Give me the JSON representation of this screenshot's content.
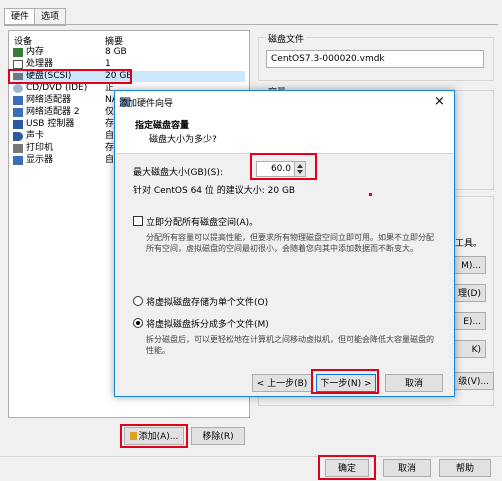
{
  "tabs": [
    "硬件",
    "选项"
  ],
  "devices": {
    "col_device": "设备",
    "col_summary": "摘要",
    "items": [
      {
        "name": "内存",
        "summary": "8 GB",
        "icon": "memory-icon"
      },
      {
        "name": "处理器",
        "summary": "1",
        "icon": "processor-icon"
      },
      {
        "name": "硬盘(SCSI)",
        "summary": "20 GB",
        "icon": "harddisk-icon"
      },
      {
        "name": "CD/DVD (IDE)",
        "summary": "正",
        "icon": "cdrom-icon"
      },
      {
        "name": "网络适配器",
        "summary": "NA",
        "icon": "network-icon"
      },
      {
        "name": "网络适配器 2",
        "summary": "仅",
        "icon": "network-icon"
      },
      {
        "name": "USB 控制器",
        "summary": "存",
        "icon": "usb-icon"
      },
      {
        "name": "声卡",
        "summary": "自",
        "icon": "sound-icon"
      },
      {
        "name": "打印机",
        "summary": "存",
        "icon": "printer-icon"
      },
      {
        "name": "显示器",
        "summary": "自",
        "icon": "display-icon"
      }
    ],
    "add_label": "添加(A)...",
    "remove_label": "移除(R)"
  },
  "right_panel": {
    "disk_file_label": "磁盘文件",
    "disk_file_value": "CentOS7.3-000020.vmdk",
    "capacity_label": "容量",
    "partial_tools": "工具。",
    "partial_btn1": "M)...",
    "partial_btn2": "理(D)",
    "partial_btn3": "E)...",
    "partial_btn4": "K)",
    "partial_btn5": "级(V)..."
  },
  "dialog": {
    "title": "添加硬件向导",
    "heading": "指定磁盘容量",
    "subheading": "磁盘大小为多少?",
    "max_size_label": "最大磁盘大小(GB)(S):",
    "max_size_value": "60.0",
    "recommend": "针对 CentOS 64 位 的建议大小: 20 GB",
    "allocate_label": "立即分配所有磁盘空间(A)。",
    "allocate_desc": "分配所有容量可以提高性能，但要求所有物理磁盘空间立即可用。如果不立即分配所有空间，虚拟磁盘的空间最初很小，会随着您向其中添加数据而不断变大。",
    "single_file_label": "将虚拟磁盘存储为单个文件(O)",
    "split_label": "将虚拟磁盘拆分成多个文件(M)",
    "split_desc": "拆分磁盘后，可以更轻松地在计算机之间移动虚拟机，但可能会降低大容量磁盘的性能。",
    "back_label": "< 上一步(B)",
    "next_label": "下一步(N) >",
    "cancel_label": "取消",
    "close_glyph": "×"
  },
  "footer": {
    "ok_label": "确定",
    "cancel_label": "取消",
    "help_label": "帮助"
  },
  "colors": {
    "highlight": "#e3001b",
    "selection": "#cce8ff",
    "dialog_border": "#1883d7"
  }
}
